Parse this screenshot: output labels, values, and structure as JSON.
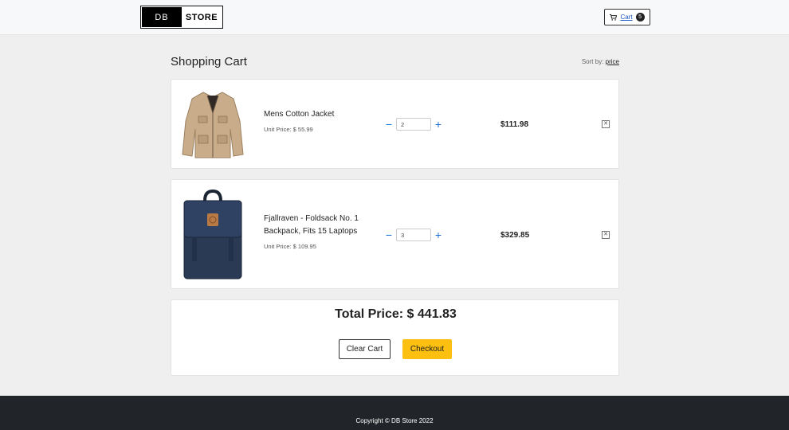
{
  "header": {
    "logo_left": "DB",
    "logo_right": "STORE",
    "cart_label": "Cart",
    "cart_count": "5"
  },
  "page": {
    "title": "Shopping Cart",
    "sort_prefix": "Sort by:",
    "sort_value": "price"
  },
  "items": [
    {
      "name": "Mens Cotton Jacket",
      "unit_price": "Unit Price: $ 55.99",
      "quantity": "2",
      "line_total": "$111.98",
      "minus": "−",
      "plus": "+",
      "remove": "✕"
    },
    {
      "name": "Fjallraven - Foldsack No. 1 Backpack, Fits 15 Laptops",
      "unit_price": "Unit Price: $ 109.95",
      "quantity": "3",
      "line_total": "$329.85",
      "minus": "−",
      "plus": "+",
      "remove": "✕"
    }
  ],
  "summary": {
    "total": "Total Price: $ 441.83",
    "clear_label": "Clear Cart",
    "checkout_label": "Checkout"
  },
  "footer": {
    "copyright": "Copyright © DB Store 2022"
  },
  "colors": {
    "accent": "#fdc010",
    "link": "#1a56c4",
    "footer_bg": "#212529"
  }
}
